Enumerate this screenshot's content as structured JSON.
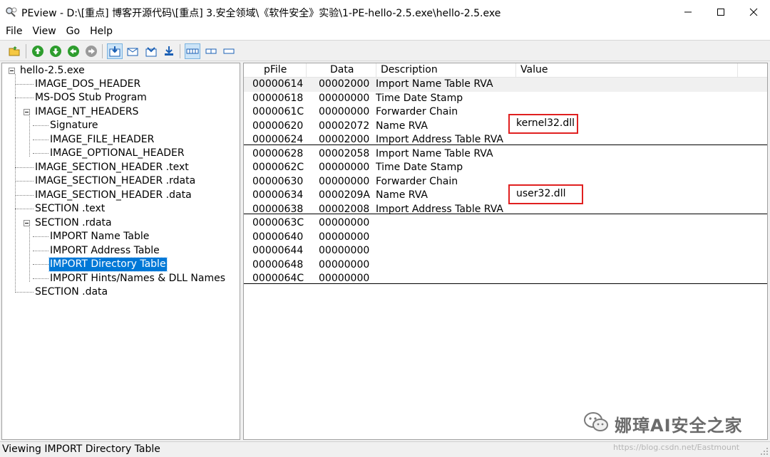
{
  "window": {
    "title": "PEview - D:\\[重点] 博客开源代码\\[重点] 3.安全领域\\《软件安全》实验\\1-PE-hello-2.5.exe\\hello-2.5.exe"
  },
  "menu": [
    "File",
    "View",
    "Go",
    "Help"
  ],
  "toolbar": {
    "icons": [
      "open-folder-icon",
      "go-up-icon",
      "go-down-icon",
      "go-back-icon",
      "go-forward-icon",
      "view-import-icon",
      "view-export-icon",
      "view-resource-icon",
      "view-download-icon",
      "view-bytes-icon",
      "view-words-icon",
      "view-dwords-icon"
    ]
  },
  "tree": {
    "root": "hello-2.5.exe",
    "nodes": [
      "IMAGE_DOS_HEADER",
      "MS-DOS Stub Program",
      "IMAGE_NT_HEADERS",
      "Signature",
      "IMAGE_FILE_HEADER",
      "IMAGE_OPTIONAL_HEADER",
      "IMAGE_SECTION_HEADER .text",
      "IMAGE_SECTION_HEADER .rdata",
      "IMAGE_SECTION_HEADER .data",
      "SECTION .text",
      "SECTION .rdata",
      "IMPORT Name Table",
      "IMPORT Address Table",
      "IMPORT Directory Table",
      "IMPORT Hints/Names & DLL Names",
      "SECTION .data"
    ],
    "selected": "IMPORT Directory Table"
  },
  "grid": {
    "columns": [
      "pFile",
      "Data",
      "Description",
      "Value"
    ],
    "rows": [
      {
        "pfile": "00000614",
        "data": "00002000",
        "desc": "Import Name Table RVA",
        "value": ""
      },
      {
        "pfile": "00000618",
        "data": "00000000",
        "desc": "Time Date Stamp",
        "value": ""
      },
      {
        "pfile": "0000061C",
        "data": "00000000",
        "desc": "Forwarder Chain",
        "value": ""
      },
      {
        "pfile": "00000620",
        "data": "00002072",
        "desc": "Name RVA",
        "value": "kernel32.dll"
      },
      {
        "pfile": "00000624",
        "data": "00002000",
        "desc": "Import Address Table RVA",
        "value": ""
      },
      {
        "pfile": "00000628",
        "data": "00002058",
        "desc": "Import Name Table RVA",
        "value": ""
      },
      {
        "pfile": "0000062C",
        "data": "00000000",
        "desc": "Time Date Stamp",
        "value": ""
      },
      {
        "pfile": "00000630",
        "data": "00000000",
        "desc": "Forwarder Chain",
        "value": ""
      },
      {
        "pfile": "00000634",
        "data": "0000209A",
        "desc": "Name RVA",
        "value": "user32.dll"
      },
      {
        "pfile": "00000638",
        "data": "00002008",
        "desc": "Import Address Table RVA",
        "value": ""
      },
      {
        "pfile": "0000063C",
        "data": "00000000",
        "desc": "",
        "value": ""
      },
      {
        "pfile": "00000640",
        "data": "00000000",
        "desc": "",
        "value": ""
      },
      {
        "pfile": "00000644",
        "data": "00000000",
        "desc": "",
        "value": ""
      },
      {
        "pfile": "00000648",
        "data": "00000000",
        "desc": "",
        "value": ""
      },
      {
        "pfile": "0000064C",
        "data": "00000000",
        "desc": "",
        "value": ""
      }
    ]
  },
  "status": "Viewing IMPORT Directory Table",
  "watermark": {
    "text": "娜璋AI安全之家",
    "url": "https://blog.csdn.net/Eastmount"
  },
  "colors": {
    "selection": "#0078d7",
    "highlight_box": "#e02020"
  }
}
